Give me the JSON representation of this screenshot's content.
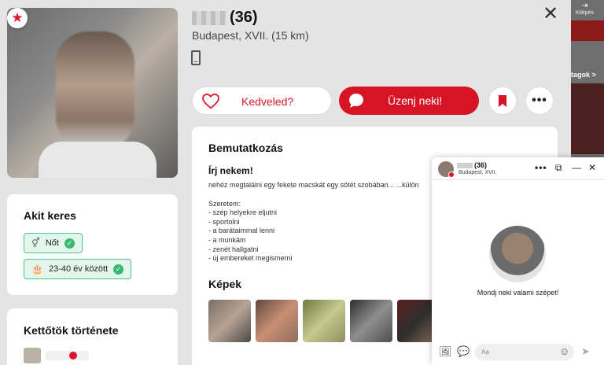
{
  "profile": {
    "age": "(36)",
    "location": "Budapest, XVII. (15 km)"
  },
  "actions": {
    "like_label": "Kedveled?",
    "message_label": "Üzenj neki!",
    "more_label": "•••"
  },
  "close_label": "✕",
  "search": {
    "title": "Akit keres",
    "gender": "Nőt",
    "age_range": "23-40 év között"
  },
  "history": {
    "title": "Kettőtök története"
  },
  "intro": {
    "title": "Bemutatkozás",
    "subtitle": "Írj nekem!",
    "text": "nehéz megtalálni egy fekete macskát egy sötét szobában... ...külön",
    "likes": "Szeretem:\n- szép helyekre eljutni\n- sportolni\n- a barátaimmal lenni\n- a munkám\n- zenét hallgatni\n- új embereket megismerni",
    "images_title": "Képek"
  },
  "background": {
    "exit_label": "Kilépés",
    "tagok_label": "tagok >"
  },
  "chat": {
    "age": "(36)",
    "location": "Budapest, XVII.",
    "hint": "Mondj neki valami szépet!",
    "input_placeholder": "Aa"
  },
  "colors": {
    "accent_red": "#d61426",
    "chip_green": "#37b873"
  }
}
